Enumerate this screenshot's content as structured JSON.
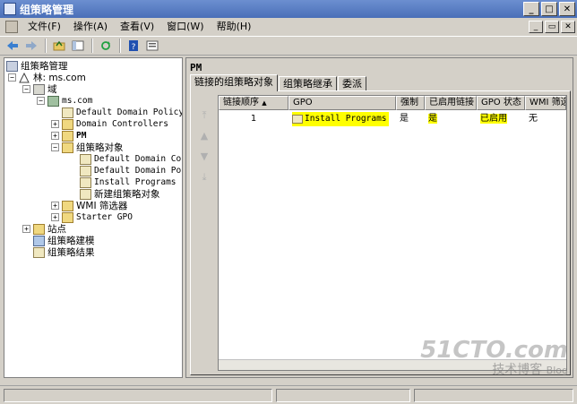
{
  "window": {
    "title": "组策略管理"
  },
  "menu": [
    "文件(F)",
    "操作(A)",
    "查看(V)",
    "窗口(W)",
    "帮助(H)"
  ],
  "tree": {
    "root": "组策略管理",
    "forest": "林: ms.com",
    "domains": "域",
    "domain": "ms.com",
    "default_policy": "Default Domain Policy",
    "domain_controllers": "Domain Controllers",
    "ou": "PM",
    "gpo_folder": "组策略对象",
    "gpos": [
      "Default Domain Contr",
      "Default Domain Polic",
      "Install Programs",
      "新建组策略对象"
    ],
    "wmi": "WMI 筛选器",
    "starter": "Starter GPO",
    "sites": "站点",
    "modeling": "组策略建模",
    "results": "组策略结果"
  },
  "right_pane": {
    "title": "PM",
    "tabs": [
      "链接的组策略对象",
      "组策略继承",
      "委派"
    ],
    "columns": [
      "链接顺序",
      "GPO",
      "强制",
      "已启用链接",
      "GPO 状态",
      "WMI 筛选"
    ],
    "rows": [
      {
        "order": "1",
        "gpo": "Install Programs",
        "enforced": "是",
        "link_enabled": "是",
        "status": "已启用",
        "wmi": "无"
      }
    ]
  },
  "watermark": {
    "big": "51CTO.com",
    "small": "技术博客",
    "tag": "Blog"
  },
  "colors": {
    "highlight": "#ffff00",
    "titlebar": "#4a6fb8"
  }
}
